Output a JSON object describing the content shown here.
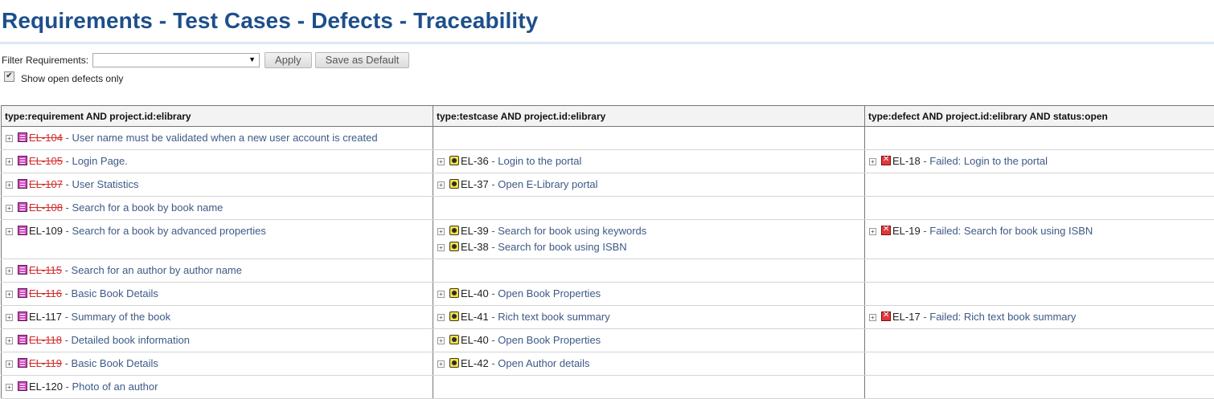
{
  "title": "Requirements - Test Cases - Defects - Traceability",
  "filter": {
    "label": "Filter Requirements:",
    "selected": "",
    "apply_label": "Apply",
    "save_default_label": "Save as Default"
  },
  "checkbox": {
    "label": "Show open defects only",
    "checked": true
  },
  "columns": [
    "type:requirement AND project.id:elibrary",
    "type:testcase AND project.id:elibrary",
    "type:defect AND project.id:elibrary AND status:open"
  ],
  "rows": [
    {
      "req": {
        "id": "EL-104",
        "title": "User name must be validated when a new user account is created",
        "resolved": true
      },
      "tests": [],
      "defects": []
    },
    {
      "req": {
        "id": "EL-105",
        "title": "Login Page.",
        "resolved": true
      },
      "tests": [
        {
          "id": "EL-36",
          "title": "Login to the portal"
        }
      ],
      "defects": [
        {
          "id": "EL-18",
          "title": "Failed: Login to the portal"
        }
      ]
    },
    {
      "req": {
        "id": "EL-107",
        "title": "User Statistics",
        "resolved": true
      },
      "tests": [
        {
          "id": "EL-37",
          "title": "Open E-Library portal"
        }
      ],
      "defects": []
    },
    {
      "req": {
        "id": "EL-108",
        "title": "Search for a book by book name",
        "resolved": true
      },
      "tests": [],
      "defects": []
    },
    {
      "req": {
        "id": "EL-109",
        "title": "Search for a book by advanced properties",
        "resolved": false
      },
      "tests": [
        {
          "id": "EL-39",
          "title": "Search for book using keywords"
        },
        {
          "id": "EL-38",
          "title": "Search for book using ISBN"
        }
      ],
      "defects": [
        {
          "id": "EL-19",
          "title": "Failed: Search for book using ISBN"
        }
      ]
    },
    {
      "req": {
        "id": "EL-115",
        "title": "Search for an author by author name",
        "resolved": true
      },
      "tests": [],
      "defects": []
    },
    {
      "req": {
        "id": "EL-116",
        "title": "Basic Book Details",
        "resolved": true
      },
      "tests": [
        {
          "id": "EL-40",
          "title": "Open Book Properties"
        }
      ],
      "defects": []
    },
    {
      "req": {
        "id": "EL-117",
        "title": "Summary of the book",
        "resolved": false
      },
      "tests": [
        {
          "id": "EL-41",
          "title": "Rich text book summary"
        }
      ],
      "defects": [
        {
          "id": "EL-17",
          "title": "Failed: Rich text book summary"
        }
      ]
    },
    {
      "req": {
        "id": "EL-118",
        "title": "Detailed book information",
        "resolved": true
      },
      "tests": [
        {
          "id": "EL-40",
          "title": "Open Book Properties"
        }
      ],
      "defects": []
    },
    {
      "req": {
        "id": "EL-119",
        "title": "Basic Book Details",
        "resolved": true
      },
      "tests": [
        {
          "id": "EL-42",
          "title": "Open Author details"
        }
      ],
      "defects": []
    },
    {
      "req": {
        "id": "EL-120",
        "title": "Photo of an author",
        "resolved": false
      },
      "tests": [],
      "defects": []
    }
  ],
  "separator": " - "
}
